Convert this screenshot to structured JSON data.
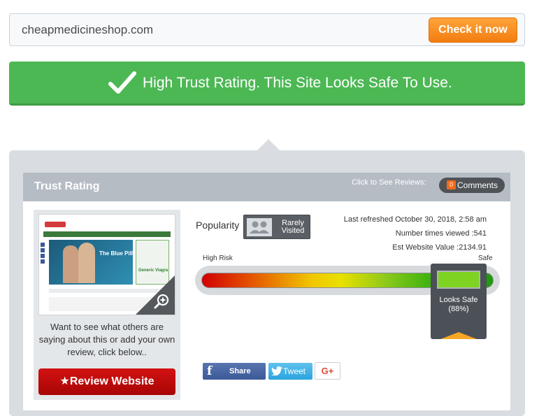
{
  "search": {
    "value": "cheapmedicineshop.com",
    "button_label": "Check it now"
  },
  "banner": {
    "text": "High Trust Rating. This Site Looks Safe To Use.",
    "color": "#4cb854"
  },
  "card": {
    "title": "Trust Rating",
    "reviews_prompt": "Click to See Reviews:",
    "comments_count": "0",
    "comments_label": "Comments"
  },
  "preview": {
    "hero_text": "The Blue Pill",
    "side_text": "Generic Viagra"
  },
  "left": {
    "prompt_text": "Want to see what others are saying about this or add your own review, click below..",
    "review_button_label": "★Review Website"
  },
  "popularity": {
    "label": "Popularity",
    "badge_text": "Rarely Visited"
  },
  "meta": {
    "last_refreshed": "Last refreshed October 30, 2018, 2:58 am",
    "times_viewed": "Number times viewed :541",
    "website_value": "Est Website Value :2134.91"
  },
  "gauge": {
    "low_label": "High Risk",
    "high_label": "Safe",
    "marker_label": "Looks Safe",
    "marker_percent": "(88%)",
    "value_fraction": 0.88
  },
  "social": {
    "facebook_label": "Share",
    "twitter_label": "Tweet",
    "gplus_label": "G+"
  },
  "colors": {
    "accent_orange": "#f27d10",
    "safe_green": "#4cb854",
    "review_red": "#c40c0c",
    "facebook_blue": "#3b5998",
    "twitter_blue": "#2aa4de"
  }
}
